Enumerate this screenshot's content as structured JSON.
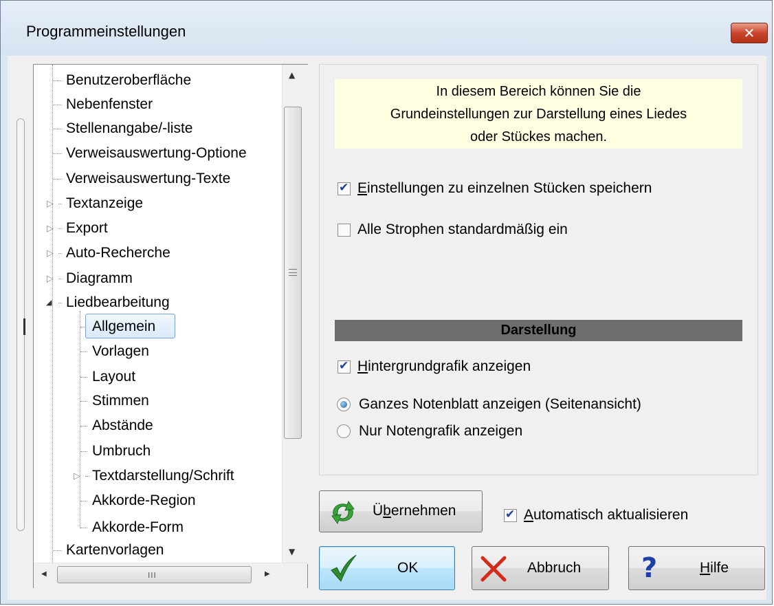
{
  "window": {
    "title": "Programmeinstellungen",
    "close_glyph": "✕"
  },
  "tree": {
    "items": [
      {
        "label": "Benutzeroberfläche",
        "expander": ""
      },
      {
        "label": "Nebenfenster",
        "expander": ""
      },
      {
        "label": "Stellenangabe/-liste",
        "expander": ""
      },
      {
        "label": "Verweisauswertung-Optione",
        "expander": ""
      },
      {
        "label": "Verweisauswertung-Texte",
        "expander": ""
      },
      {
        "label": "Textanzeige",
        "expander": "▷"
      },
      {
        "label": "Export",
        "expander": "▷"
      },
      {
        "label": "Auto-Recherche",
        "expander": "▷"
      },
      {
        "label": "Diagramm",
        "expander": "▷"
      },
      {
        "label": "Liedbearbeitung",
        "expander": "◢"
      },
      {
        "label": "Kartenvorlagen",
        "expander": ""
      }
    ],
    "children": [
      {
        "label": "Allgemein",
        "selected": true
      },
      {
        "label": "Vorlagen"
      },
      {
        "label": "Layout"
      },
      {
        "label": "Stimmen"
      },
      {
        "label": "Abstände"
      },
      {
        "label": "Umbruch"
      },
      {
        "label": "Textdarstellung/Schrift",
        "expander": "▷"
      },
      {
        "label": "Akkorde-Region"
      },
      {
        "label": "Akkorde-Form"
      }
    ],
    "scroll_grip": "III"
  },
  "info": {
    "line1": "In diesem Bereich können Sie die",
    "line2": "Grundeinstellungen zur Darstellung eines Liedes",
    "line3": "oder Stückes machen."
  },
  "options": {
    "save_per_piece": {
      "accel": "E",
      "rest": "instellungen zu einzelnen Stücken speichern",
      "checked": true
    },
    "all_verses": {
      "label": "Alle Strophen standardmäßig ein",
      "checked": false
    }
  },
  "darstellung": {
    "title": "Darstellung",
    "background_graphic": {
      "accel": "H",
      "rest": "intergrundgrafik anzeigen",
      "checked": true
    },
    "radio_full_sheet": {
      "label": "Ganzes Notenblatt anzeigen (Seitenansicht)",
      "checked": true
    },
    "radio_notes_only": {
      "label": "Nur Notengrafik anzeigen",
      "checked": false
    }
  },
  "apply": {
    "pre": "Ü",
    "accel": "b",
    "rest": "ernehmen"
  },
  "auto_update": {
    "accel": "A",
    "rest": "utomatisch aktualisieren",
    "checked": true
  },
  "buttons": {
    "ok": "OK",
    "cancel": "Abbruch",
    "help_accel": "H",
    "help_rest": "ilfe"
  },
  "colors": {
    "info_bg": "#ffffe1",
    "section_bar": "#6d6d6d",
    "ok_check": "#2e8b2e",
    "cancel_x": "#d42a1a",
    "help_q": "#1f3fa8"
  }
}
